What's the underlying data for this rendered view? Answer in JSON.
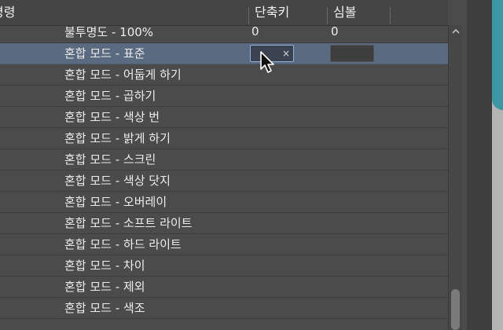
{
  "header": {
    "command_col": "명령",
    "shortcut_col": "단축키",
    "symbol_col": "심볼"
  },
  "rows": [
    {
      "label": "불투명도 - 100%",
      "shortcut": "0",
      "symbol": "0"
    },
    {
      "label": "혼합 모드 - 표준",
      "selected": true
    },
    {
      "label": "혼합 모드 - 어둡게 하기"
    },
    {
      "label": "혼합 모드 - 곱하기"
    },
    {
      "label": "혼합 모드 - 색상 번"
    },
    {
      "label": "혼합 모드 - 밝게 하기"
    },
    {
      "label": "혼합 모드 - 스크린"
    },
    {
      "label": "혼합 모드 - 색상 닷지"
    },
    {
      "label": "혼합 모드 - 오버레이"
    },
    {
      "label": "혼합 모드 - 소프트 라이트"
    },
    {
      "label": "혼합 모드 - 하드 라이트"
    },
    {
      "label": "혼합 모드 - 차이"
    },
    {
      "label": "혼합 모드 - 제외"
    },
    {
      "label": "혼합 모드 - 색조"
    }
  ],
  "editor": {
    "clear_glyph": "×"
  },
  "colors": {
    "selected_row": "#5a6a80",
    "focus_border": "#8fb1d8",
    "accent_teal": "#3a97a3"
  },
  "icons": {
    "scroll_up": "chevron-up-icon",
    "pointer": "mouse-cursor-icon"
  }
}
